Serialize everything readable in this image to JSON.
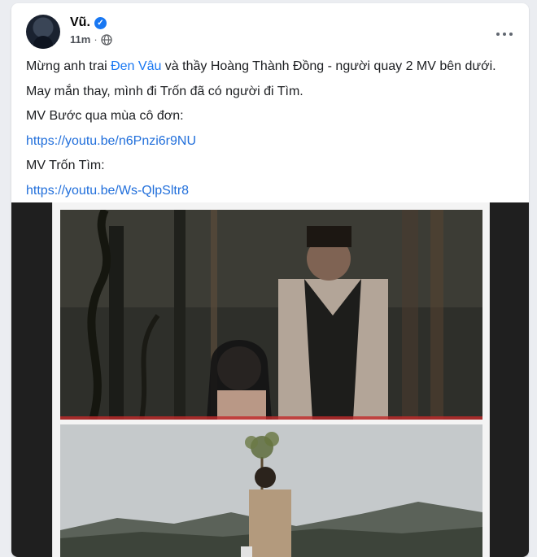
{
  "post": {
    "author": "Vũ.",
    "time": "11m",
    "separator": "·",
    "verified_icon": "check-icon",
    "privacy_icon": "globe-icon",
    "text": {
      "line1_before": "Mừng anh trai ",
      "line1_mention": "Đen Vâu",
      "line1_after": " và thầy Hoàng Thành Đồng - người quay 2 MV bên dưới.",
      "line2": "May mắn thay, mình đi Trốn đã có người đi Tìm.",
      "line3": "MV Bước qua mùa cô đơn:",
      "link1": "https://youtu.be/n6Pnzi6r9NU",
      "line4": "MV Trốn Tìm:",
      "link2": "https://youtu.be/Ws-QlpSltr8"
    }
  },
  "colors": {
    "accent": "#1877f2",
    "link": "#216fdb",
    "page_bg": "#ebedf1"
  }
}
